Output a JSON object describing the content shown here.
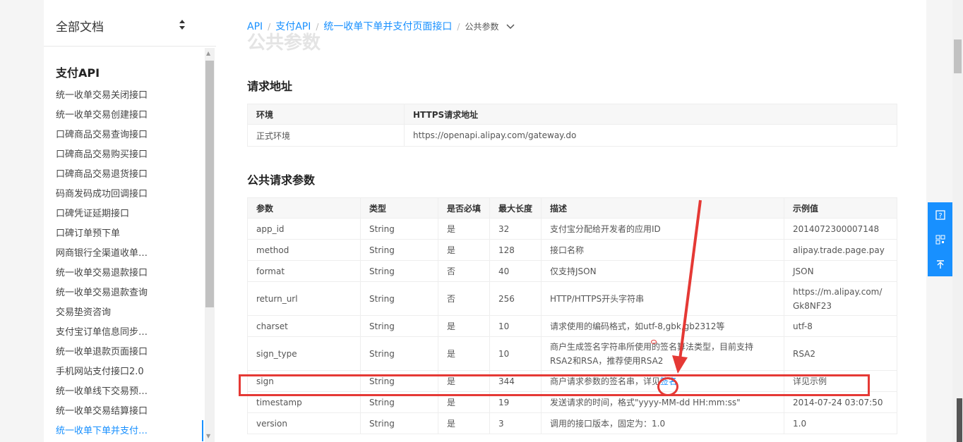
{
  "doc_panel": {
    "title": "全部文档",
    "section": "支付API",
    "items": [
      "统一收单交易关闭接口",
      "统一收单交易创建接口",
      "口碑商品交易查询接口",
      "口碑商品交易购买接口",
      "口碑商品交易退货接口",
      "码商发码成功回调接口",
      "口碑凭证延期接口",
      "口碑订单预下单",
      "网商银行全渠道收单…",
      "统一收单交易退款接口",
      "统一收单交易退款查询",
      "交易垫资咨询",
      "支付宝订单信息同步…",
      "统一收单退款页面接口",
      "手机网站支付接口2.0",
      "统一收单线下交易预…",
      "统一收单交易结算接口",
      "统一收单下单并支付…"
    ],
    "active_index": 17
  },
  "breadcrumb": {
    "items": [
      "API",
      "支付API",
      "统一收单下单并支付页面接口"
    ],
    "current": "公共参数"
  },
  "ghost_title": "公共参数",
  "request_url": {
    "heading": "请求地址",
    "headers": [
      "环境",
      "HTTPS请求地址"
    ],
    "rows": [
      [
        "正式环境",
        "https://openapi.alipay.com/gateway.do"
      ]
    ]
  },
  "params": {
    "heading": "公共请求参数",
    "headers": [
      "参数",
      "类型",
      "是否必填",
      "最大长度",
      "描述",
      "示例值"
    ],
    "rows": [
      [
        "app_id",
        "String",
        "是",
        "32",
        "支付宝分配给开发者的应用ID",
        "2014072300007148"
      ],
      [
        "method",
        "String",
        "是",
        "128",
        "接口名称",
        "alipay.trade.page.pay"
      ],
      [
        "format",
        "String",
        "否",
        "40",
        "仅支持JSON",
        "JSON"
      ],
      [
        "return_url",
        "String",
        "否",
        "256",
        "HTTP/HTTPS开头字符串",
        "https://m.alipay.com/Gk8NF23"
      ],
      [
        "charset",
        "String",
        "是",
        "10",
        "请求使用的编码格式，如utf-8,gbk,gb2312等",
        "utf-8"
      ],
      [
        "sign_type",
        "String",
        "是",
        "10",
        "商户生成签名字符串所使用的签名算法类型，目前支持RSA2和RSA，推荐使用RSA2",
        "RSA2"
      ],
      [
        "sign",
        "String",
        "是",
        "344",
        "商户请求参数的签名串，详见",
        "详见示例"
      ],
      [
        "timestamp",
        "String",
        "是",
        "19",
        "发送请求的时间，格式\"yyyy-MM-dd HH:mm:ss\"",
        "2014-07-24 03:07:50"
      ],
      [
        "version",
        "String",
        "是",
        "3",
        "调用的接口版本，固定为：1.0",
        "1.0"
      ]
    ],
    "sign_link": "签名"
  },
  "side_widget": {
    "icons": [
      "help-icon",
      "qrcode-icon",
      "back-to-top-icon"
    ]
  },
  "colors": {
    "accent": "#1890ff",
    "annotation": "#e53935"
  }
}
